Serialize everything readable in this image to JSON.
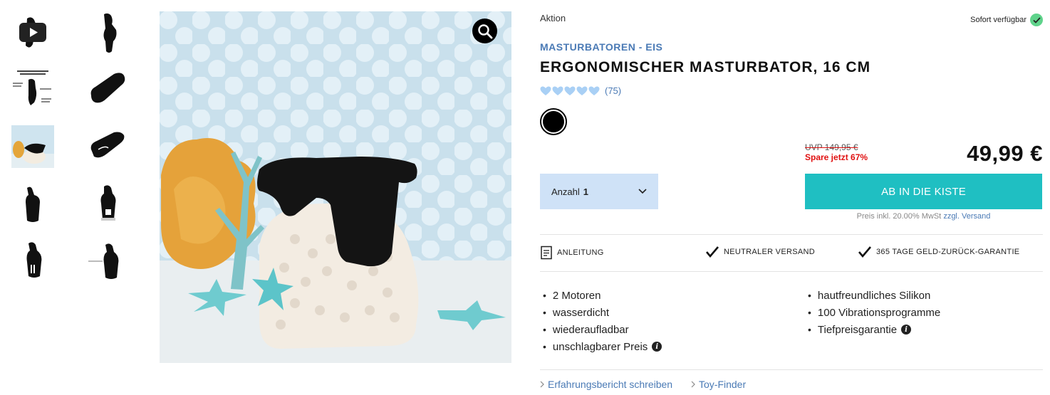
{
  "product": {
    "promo_label": "Aktion",
    "availability": "Sofort verfügbar",
    "category": "MASTURBATOREN",
    "breadcrumb_sep": "-",
    "subcategory": "EIS",
    "title": "ERGONOMISCHER MASTURBATOR, 16 CM",
    "rating_count": "(75)",
    "rating_value": 5,
    "color_swatch": "#000000",
    "uvp": "UVP 149,95 €",
    "saving": "Spare jetzt 67%",
    "price": "49,99 €"
  },
  "purchase": {
    "qty_label": "Anzahl",
    "qty_value": "1",
    "cart_button": "AB IN DIE KISTE",
    "tax_note": "Preis inkl. 20.00% MwSt",
    "shipping_link": "zzgl. Versand"
  },
  "features": {
    "manual": "ANLEITUNG",
    "shipping": "NEUTRALER VERSAND",
    "guarantee": "365 TAGE GELD-ZURÜCK-GARANTIE"
  },
  "bullets_left": [
    "2 Motoren",
    "wasserdicht",
    "wiederaufladbar",
    "unschlagbarer Preis"
  ],
  "bullets_right": [
    "hautfreundliches Silikon",
    "100 Vibrationsprogramme",
    "Tiefpreisgarantie"
  ],
  "links": {
    "review": "Erfahrungsbericht schreiben",
    "toy_finder": "Toy-Finder"
  },
  "colors": {
    "accent_blue": "#4a7ab5",
    "cart_teal": "#1fbfc2",
    "qty_bg": "#cfe2f7",
    "sale_red": "#e01010",
    "available_green": "#5fd38b",
    "star_blue": "#a9d0f5"
  },
  "icons": {
    "zoom": "magnifier-icon",
    "availability": "check-circle-icon",
    "manual": "document-icon",
    "features": "checkmark-icon",
    "info": "info-icon",
    "links": "chevron-right-icon",
    "video": "play-icon"
  }
}
